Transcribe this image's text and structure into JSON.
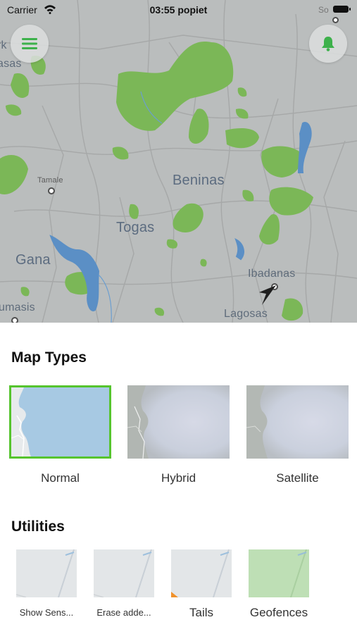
{
  "status_bar": {
    "carrier": "Carrier",
    "time": "03:55 popiet",
    "right_hint": "So"
  },
  "map": {
    "labels": {
      "tamale": "Tamale",
      "beninas": "Beninas",
      "togas": "Togas",
      "gana": "Gana",
      "ibadanas": "Ibadanas",
      "lagosas": "Lagosas",
      "kumasis": "umasis",
      "rk": "rk",
      "asas": "asas"
    },
    "colors": {
      "land": "#b9bcbc",
      "park": "#7ab858",
      "water": "#4f8bc9",
      "road": "#a7a9a9"
    }
  },
  "buttons": {
    "menu_icon": "menu-icon",
    "bell_icon": "bell-icon",
    "accent": "#3db14b"
  },
  "map_types": {
    "title": "Map Types",
    "items": [
      {
        "label": "Normal",
        "selected": true
      },
      {
        "label": "Hybrid",
        "selected": false
      },
      {
        "label": "Satellite",
        "selected": false
      }
    ]
  },
  "utilities": {
    "title": "Utilities",
    "items": [
      {
        "label": "Show Sens..."
      },
      {
        "label": "Erase adde..."
      },
      {
        "label": "Tails"
      },
      {
        "label": "Geofences"
      }
    ]
  }
}
